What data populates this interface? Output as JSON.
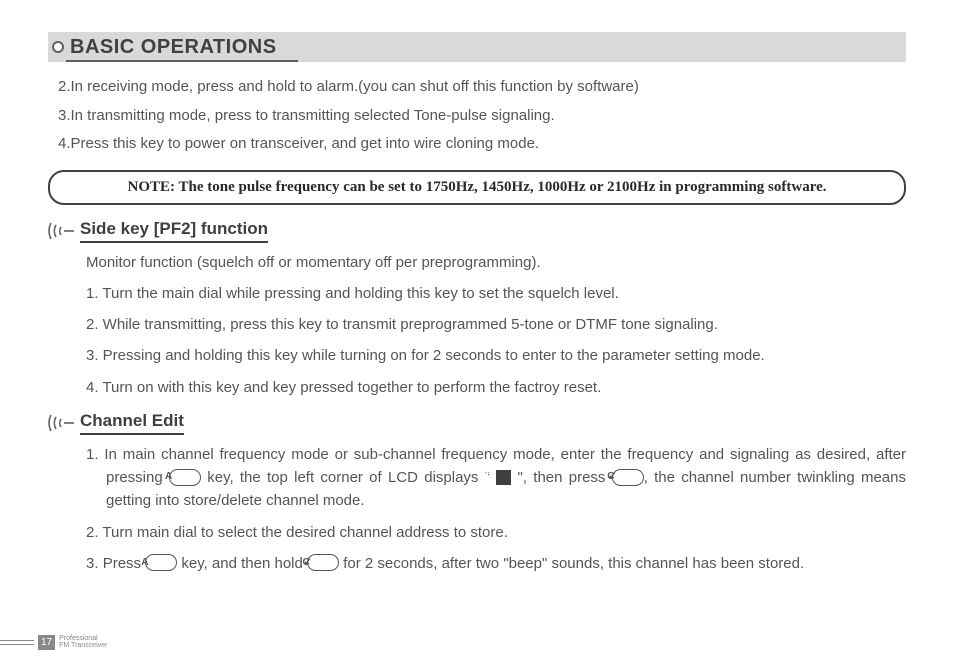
{
  "header": {
    "title": "BASIC OPERATIONS"
  },
  "intro_items": [
    "2.In receiving mode, press and hold to alarm.(you can shut off this function by software)",
    "3.In transmitting mode, press to transmitting selected Tone-pulse signaling.",
    "4.Press this key to power on transceiver, and get into wire cloning mode."
  ],
  "note": "NOTE: The tone pulse frequency can be set to 1750Hz, 1450Hz, 1000Hz or 2100Hz in programming software.",
  "section_pf2": {
    "title": "Side key [PF2] function",
    "intro": "Monitor function (squelch off or momentary off per preprogramming).",
    "items": [
      "1. Turn the main dial while pressing and holding this key to set the squelch level.",
      "2. While transmitting, press this key to transmit preprogrammed 5-tone or DTMF tone signaling.",
      "3. Pressing and holding this key while turning on for 2 seconds to enter to the parameter setting mode.",
      "4. Turn on with this key and key pressed together to perform the factroy reset."
    ]
  },
  "section_channel": {
    "title": "Channel Edit",
    "item1": {
      "num": "1.",
      "t1": "In main channel frequency mode or sub-channel frequency mode, enter the frequency and signaling as desired, after pressing ",
      "key_a": "A",
      "t2": " key, the top left corner of LCD displays \" ",
      "f": "F",
      "t3": " \", then press ",
      "key_c": "C",
      "tick": "✓",
      "t4": ", the channel number twinkling means getting into store/delete channel mode."
    },
    "item2": "2. Turn main dial to select the desired channel address to store.",
    "item3": {
      "num": "3.",
      "t1": "Press ",
      "key_a": "A",
      "t2": " key, and then hold ",
      "key_c": "C",
      "tick": "✓",
      "t3": " for 2 seconds, after two \"beep\" sounds, this channel has been stored."
    }
  },
  "footer": {
    "page": "17",
    "line1": "Professional",
    "line2": "FM Transceiver"
  }
}
